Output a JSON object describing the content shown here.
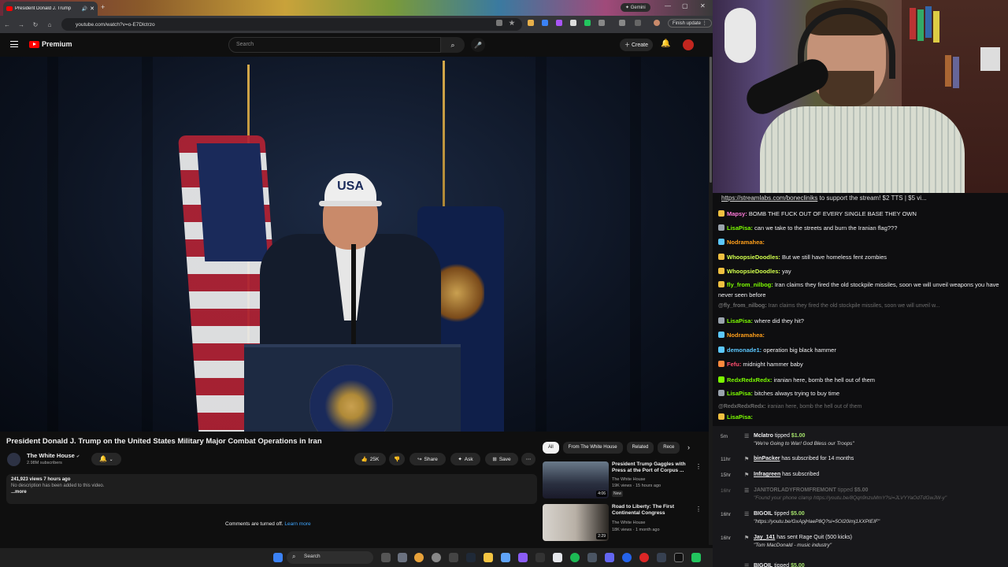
{
  "browser": {
    "tab_title": "President Donald J. Trump",
    "gemini_label": "Gemini",
    "url": "youtube.com/watch?v=o-E7Dlctrzo",
    "finish_update": "Finish update"
  },
  "youtube": {
    "logo_text": "Premium",
    "search_placeholder": "Search",
    "create_label": "Create"
  },
  "video": {
    "cap_text": "USA",
    "title": "President Donald J. Trump on the United States Military Major Combat Operations in Iran",
    "channel_name": "The White House",
    "subscribers": "2.98M subscribers",
    "likes": "25K",
    "share_label": "Share",
    "ask_label": "Ask",
    "save_label": "Save",
    "views_meta": "241,923 views  7 hours ago",
    "description": "No description has been added to this video.",
    "more_label": "...more",
    "comments_off": "Comments are turned off.",
    "learn_more": "Learn more"
  },
  "recommendations": {
    "chips": [
      "All",
      "From The White House",
      "Related",
      "Rece"
    ],
    "items": [
      {
        "title": "President Trump Gaggles with Press at the Port of Corpus ...",
        "channel": "The White House",
        "meta": "19K views · 15 hours ago",
        "badge": "New",
        "duration": "4:06"
      },
      {
        "title": "Road to Liberty: The First Continental Congress",
        "channel": "The White House",
        "meta": "18K views · 1 month ago",
        "badge": "",
        "duration": "2:29"
      }
    ]
  },
  "taskbar": {
    "search_label": "Search"
  },
  "chat": {
    "banner_link": "https://streamlabs.com/bonecliniks",
    "banner_text": " to support the stream! $2 TTS | $5 vi...",
    "messages": [
      {
        "user": "Mapsy",
        "text": "BOMB THE FUCK OUT OF EVERY SINGLE BASE THEY OWN",
        "color": "#ff7ad9",
        "dim": false
      },
      {
        "user": "LisaPisa",
        "text": "can we take to the streets and burn the Iranian flag???",
        "color": "#7cfc00",
        "dim": false
      },
      {
        "user": "Nodramahea",
        "text": "",
        "color": "#ff9f1a",
        "dim": false
      },
      {
        "user": "WhoopsieDoodles",
        "text": "But we still have homeless fent zombies",
        "color": "#d2ff4d",
        "dim": false
      },
      {
        "user": "WhoopsieDoodles",
        "text": "yay",
        "color": "#d2ff4d",
        "dim": false
      },
      {
        "user": "fly_from_nilbog",
        "text": "Iran claims they fired the old stockpile missiles, soon we will unveil weapons you have never seen before",
        "color": "#7cfc00",
        "dim": false
      },
      {
        "user": "@fly_from_nilbog",
        "text": "Iran claims they fired the old stockpile missiles, soon we will unveil w...",
        "color": "#6e6e6e",
        "dim": true
      },
      {
        "user": "LisaPisa",
        "text": "where did they hit?",
        "color": "#7cfc00",
        "dim": false
      },
      {
        "user": "Nodramahea",
        "text": "",
        "color": "#ff9f1a",
        "dim": false
      },
      {
        "user": "demonade1",
        "text": "operation big black hammer",
        "color": "#5cc8ff",
        "dim": false
      },
      {
        "user": "Fefu",
        "text": "midnight hammer baby",
        "color": "#ff4d6d",
        "dim": false
      },
      {
        "user": "RedxRedxRedx",
        "text": "iranian here, bomb the hell out of them",
        "color": "#7cfc00",
        "dim": false
      },
      {
        "user": "LisaPisa",
        "text": "bitches always trying to buy time",
        "color": "#7cfc00",
        "dim": false
      },
      {
        "user": "@RedxRedxRedx",
        "text": "iranian here, bomb the hell out of them",
        "color": "#6e6e6e",
        "dim": true
      },
      {
        "user": "LisaPisa",
        "text": "",
        "color": "#7cfc00",
        "dim": false
      }
    ]
  },
  "events": [
    {
      "age": "5m",
      "user": "Mclatro",
      "action": " tipped ",
      "amount": "$1.00",
      "sub": "\"We're Going to War! God Bless our Troops\"",
      "faded": false,
      "underline": false
    },
    {
      "age": "11hr",
      "user": "binPacker",
      "action": " has subscribed for 14 months",
      "amount": "",
      "sub": "",
      "faded": false,
      "underline": true
    },
    {
      "age": "15hr",
      "user": "Infragreen",
      "action": " has subscribed",
      "amount": "",
      "sub": "",
      "faded": false,
      "underline": true
    },
    {
      "age": "16hr",
      "user": "JANITORLADYFROMFREMONT",
      "action": " tipped ",
      "amount": "$5.00",
      "sub": "\"Found your phone clamp https://youtu.be/8Qqn9nzuMmY?si=JLVYYaOdTdGwJW-y\"",
      "faded": true,
      "underline": false
    },
    {
      "age": "16hr",
      "user": "BIGOIL",
      "action": " tipped ",
      "amount": "$5.00",
      "sub": "\"https://youtu.be/GxApjHaeP8Q?si=5OI20imj1XXPIEIF\"",
      "faded": false,
      "underline": false
    },
    {
      "age": "16hr",
      "user": "Jay_141",
      "action": " has sent Rage Quit (500 kicks)",
      "amount": "",
      "sub": "\"Tom MacDonald - music industry\"",
      "faded": false,
      "underline": true
    },
    {
      "age": "",
      "user": "BIGOIL",
      "action": " tipped ",
      "amount": "$5.00",
      "sub": "",
      "faded": false,
      "underline": false
    }
  ]
}
